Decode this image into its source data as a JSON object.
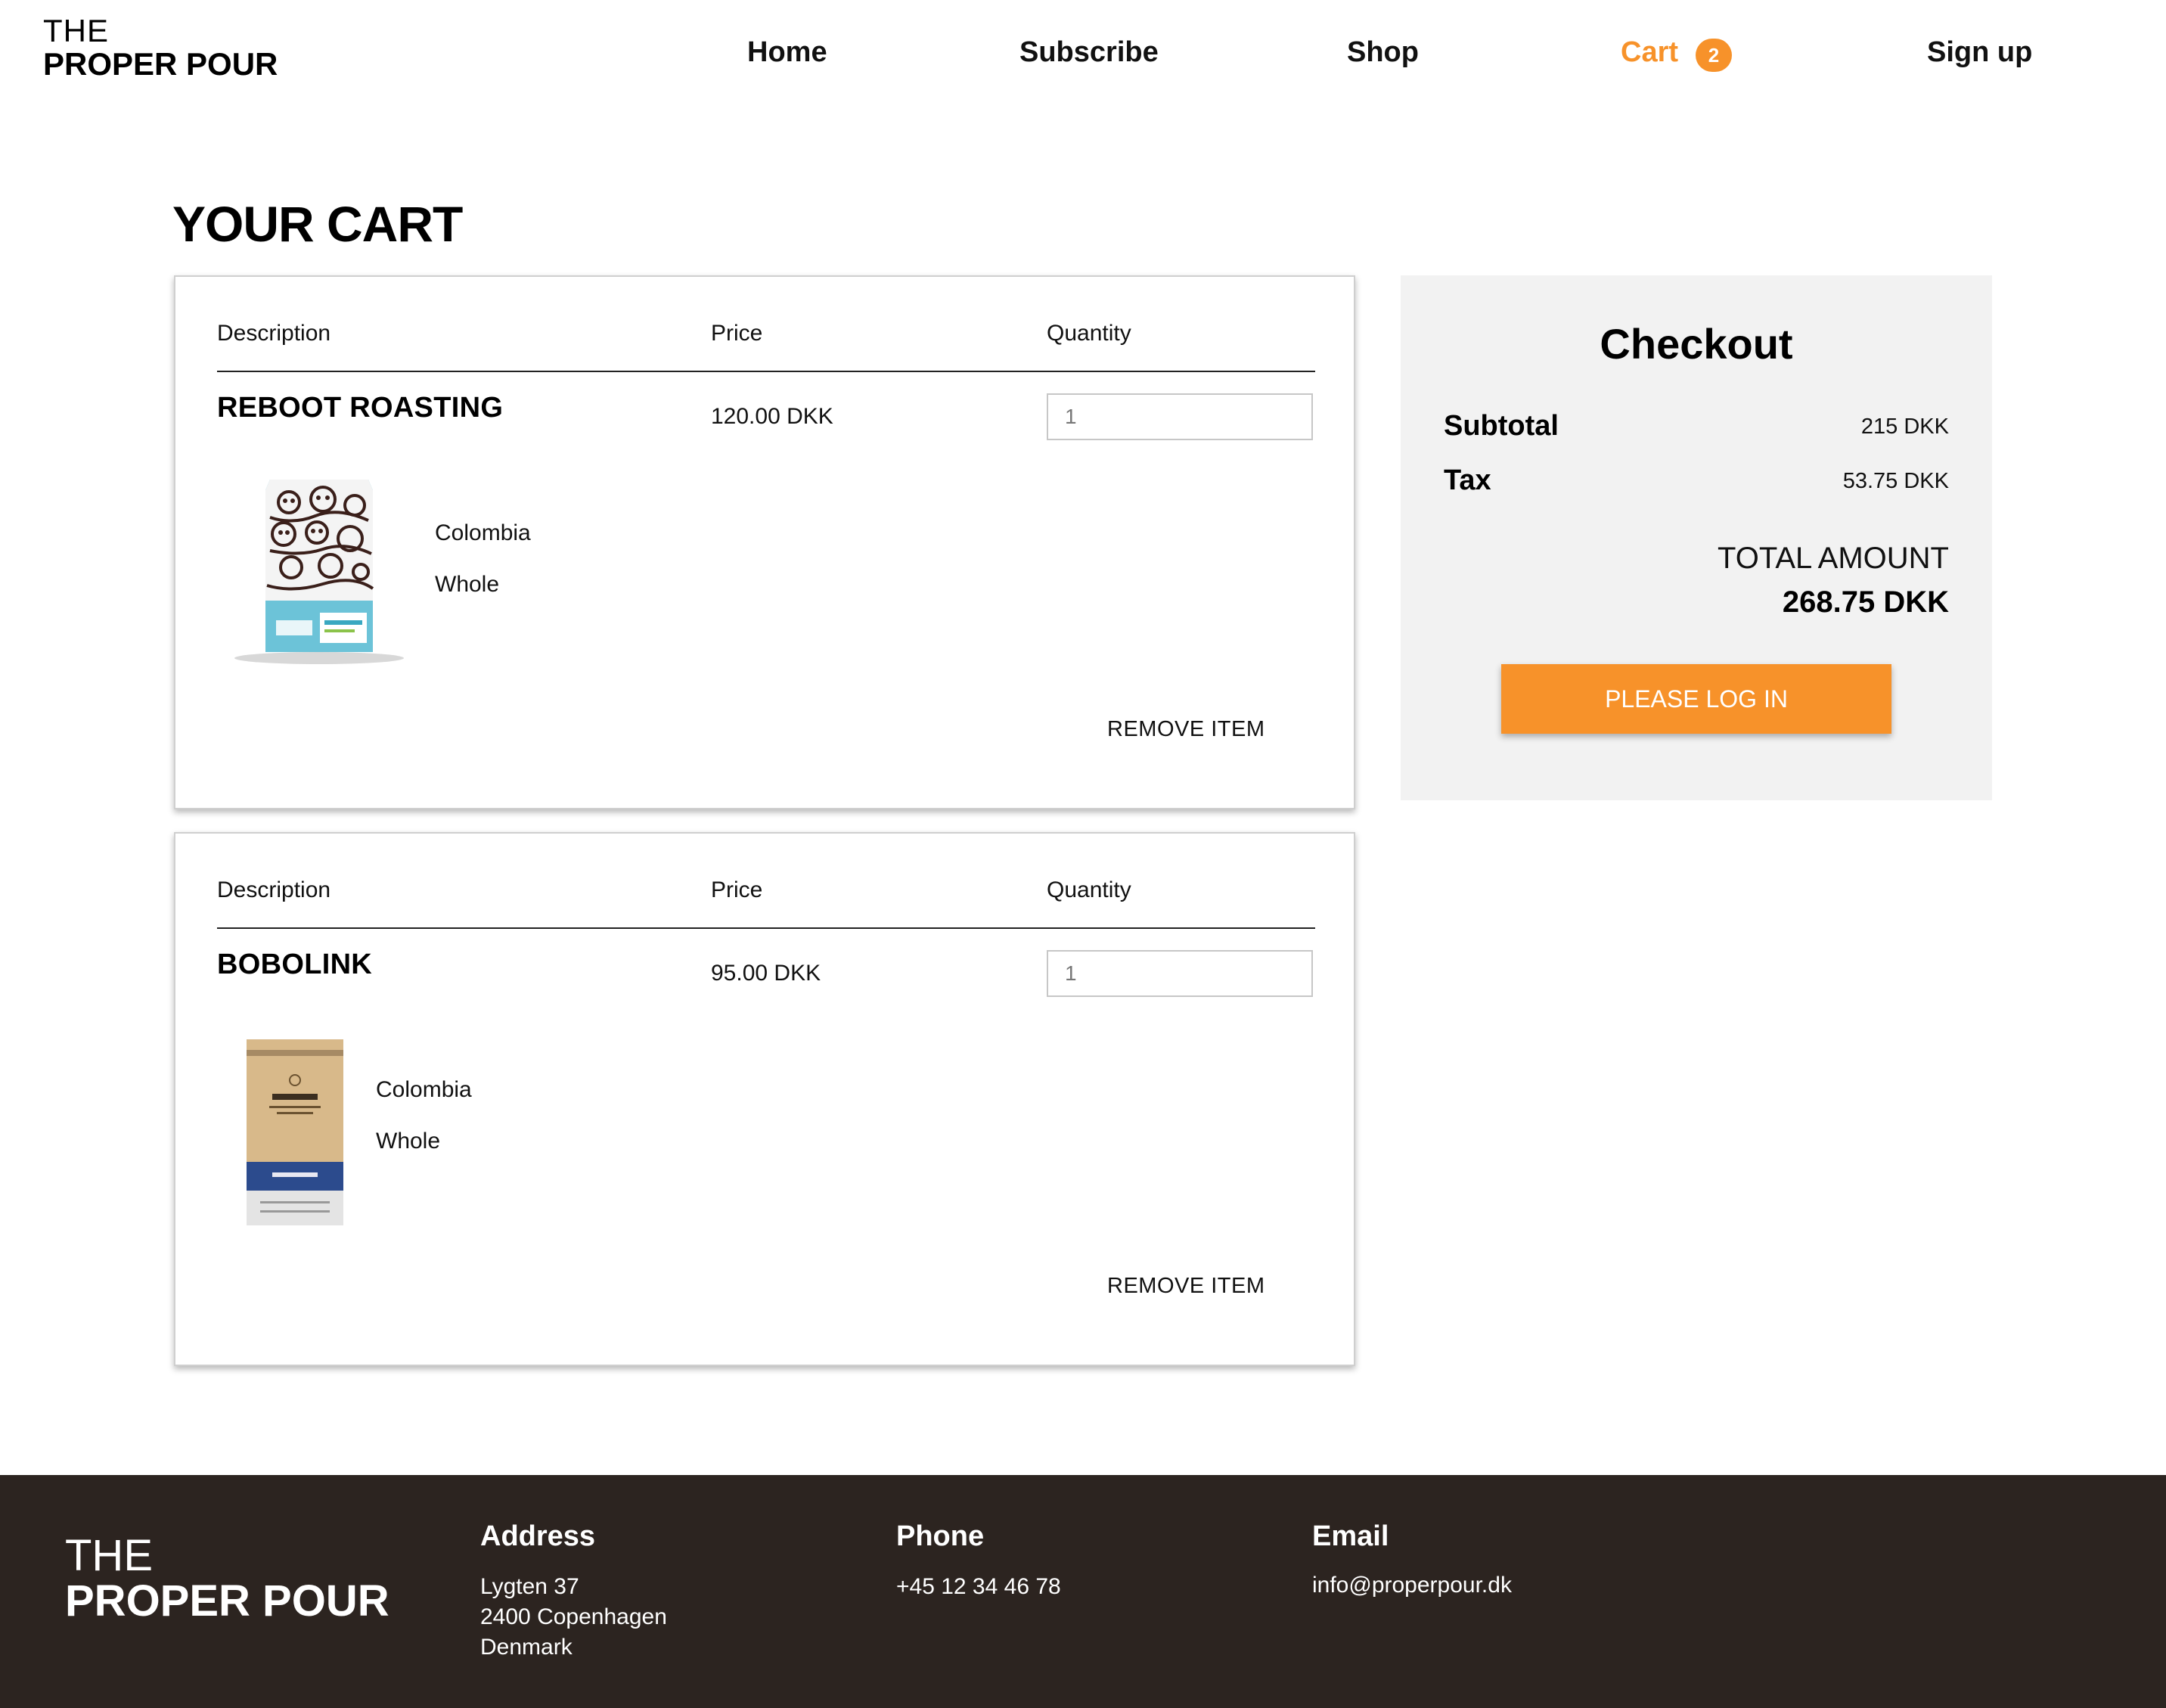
{
  "header": {
    "logo_line1": "THE",
    "logo_line2": "PROPER POUR",
    "nav": {
      "home": "Home",
      "subscribe": "Subscribe",
      "shop": "Shop",
      "cart": "Cart",
      "cart_count": "2",
      "signup": "Sign up"
    },
    "active_color": "#f7922a"
  },
  "page_title": "YOUR CART",
  "cart_items": [
    {
      "col_description": "Description",
      "col_price": "Price",
      "col_quantity": "Quantity",
      "name": "REBOOT ROASTING",
      "price": "120.00 DKK",
      "quantity": "1",
      "origin": "Colombia",
      "grind": "Whole",
      "remove_label": "REMOVE ITEM",
      "image_icon": "reboot-coffee-bag"
    },
    {
      "col_description": "Description",
      "col_price": "Price",
      "col_quantity": "Quantity",
      "name": "BOBOLINK",
      "price": "95.00 DKK",
      "quantity": "1",
      "origin": "Colombia",
      "grind": "Whole",
      "remove_label": "REMOVE ITEM",
      "image_icon": "union-coffee-bag"
    }
  ],
  "checkout": {
    "title": "Checkout",
    "subtotal_label": "Subtotal",
    "subtotal_value": "215 DKK",
    "tax_label": "Tax",
    "tax_value": "53.75 DKK",
    "total_label": "TOTAL AMOUNT",
    "total_value": "268.75 DKK",
    "button_label": "PLEASE LOG IN"
  },
  "footer": {
    "logo_line1": "THE",
    "logo_line2": "PROPER POUR",
    "address_heading": "Address",
    "address_line1": "Lygten 37",
    "address_line2": "2400 Copenhagen",
    "address_line3": "Denmark",
    "phone_heading": "Phone",
    "phone": "+45 12 34 46 78",
    "email_heading": "Email",
    "email": "info@properpour.dk"
  }
}
